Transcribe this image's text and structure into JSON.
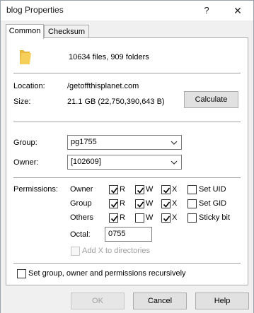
{
  "window": {
    "title": "blog Properties",
    "help_glyph": "?",
    "close_glyph": "✕"
  },
  "tabs": [
    {
      "label": "Common",
      "active": true
    },
    {
      "label": "Checksum",
      "active": false
    }
  ],
  "summary": {
    "icon": "folder-icon",
    "text": "10634 files, 909 folders"
  },
  "location": {
    "label": "Location:",
    "value": "/getoffthisplanet.com"
  },
  "size": {
    "label": "Size:",
    "value": "21.1 GB (22,750,390,643 B)"
  },
  "calculate_label": "Calculate",
  "group": {
    "label": "Group:",
    "value": "pg1755"
  },
  "owner": {
    "label": "Owner:",
    "value": "[102609]"
  },
  "permissions": {
    "label": "Permissions:",
    "rows": [
      {
        "name": "Owner",
        "r": true,
        "w": true,
        "x": true,
        "extra_label": "Set UID",
        "extra": false
      },
      {
        "name": "Group",
        "r": true,
        "w": true,
        "x": true,
        "extra_label": "Set GID",
        "extra": false
      },
      {
        "name": "Others",
        "r": true,
        "w": false,
        "x": true,
        "extra_label": "Sticky bit",
        "extra": false
      }
    ],
    "r_label": "R",
    "w_label": "W",
    "x_label": "X",
    "octal_label": "Octal:",
    "octal_value": "0755",
    "add_x_label": "Add X to directories"
  },
  "recursive_label": "Set group, owner and permissions recursively",
  "buttons": {
    "ok": "OK",
    "cancel": "Cancel",
    "help": "Help"
  }
}
